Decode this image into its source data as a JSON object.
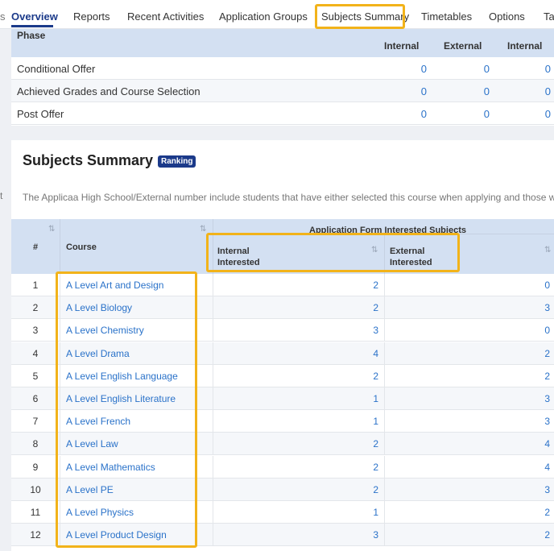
{
  "tabs": [
    "Overview",
    "Reports",
    "Recent Activities",
    "Application Groups",
    "Subjects Summary",
    "Timetables",
    "Options",
    "Ta"
  ],
  "left_cut_chars": [
    "s",
    "t"
  ],
  "phase_table": {
    "header_label": "Phase",
    "columns": [
      "Internal",
      "External",
      "Internal"
    ],
    "rows": [
      {
        "label": "Conditional Offer",
        "values": [
          "0",
          "0",
          "0"
        ]
      },
      {
        "label": "Achieved Grades and Course Selection",
        "values": [
          "0",
          "0",
          "0"
        ]
      },
      {
        "label": "Post Offer",
        "values": [
          "0",
          "0",
          "0"
        ]
      }
    ]
  },
  "subjects": {
    "title": "Subjects Summary",
    "badge": "Ranking",
    "note": "The Applicaa High School/External number include students that have either selected this course when applying and those w",
    "headers": {
      "num": "#",
      "course": "Course",
      "group": "Application Form Interested Subjects",
      "internal_line1": "Internal",
      "internal_line2": "Interested",
      "external_line1": "External",
      "external_line2": "Interested"
    },
    "rows": [
      {
        "num": "1",
        "course": "A Level Art and Design",
        "internal": "2",
        "external": "0"
      },
      {
        "num": "2",
        "course": "A Level Biology",
        "internal": "2",
        "external": "3"
      },
      {
        "num": "3",
        "course": "A Level Chemistry",
        "internal": "3",
        "external": "0"
      },
      {
        "num": "4",
        "course": "A Level Drama",
        "internal": "4",
        "external": "2"
      },
      {
        "num": "5",
        "course": "A Level English Language",
        "internal": "2",
        "external": "2"
      },
      {
        "num": "6",
        "course": "A Level English Literature",
        "internal": "1",
        "external": "3"
      },
      {
        "num": "7",
        "course": "A Level French",
        "internal": "1",
        "external": "3"
      },
      {
        "num": "8",
        "course": "A Level Law",
        "internal": "2",
        "external": "4"
      },
      {
        "num": "9",
        "course": "A Level Mathematics",
        "internal": "2",
        "external": "4"
      },
      {
        "num": "10",
        "course": "A Level PE",
        "internal": "2",
        "external": "3"
      },
      {
        "num": "11",
        "course": "A Level Physics",
        "internal": "1",
        "external": "2"
      },
      {
        "num": "12",
        "course": "A Level Product Design",
        "internal": "3",
        "external": "2"
      }
    ]
  },
  "colors": {
    "accent": "#1b3a8a",
    "link": "#2a72c9",
    "highlight": "#f2b31a",
    "header_bg": "#d3e0f2"
  },
  "icons": {
    "sort": "sort-arrows-icon"
  }
}
